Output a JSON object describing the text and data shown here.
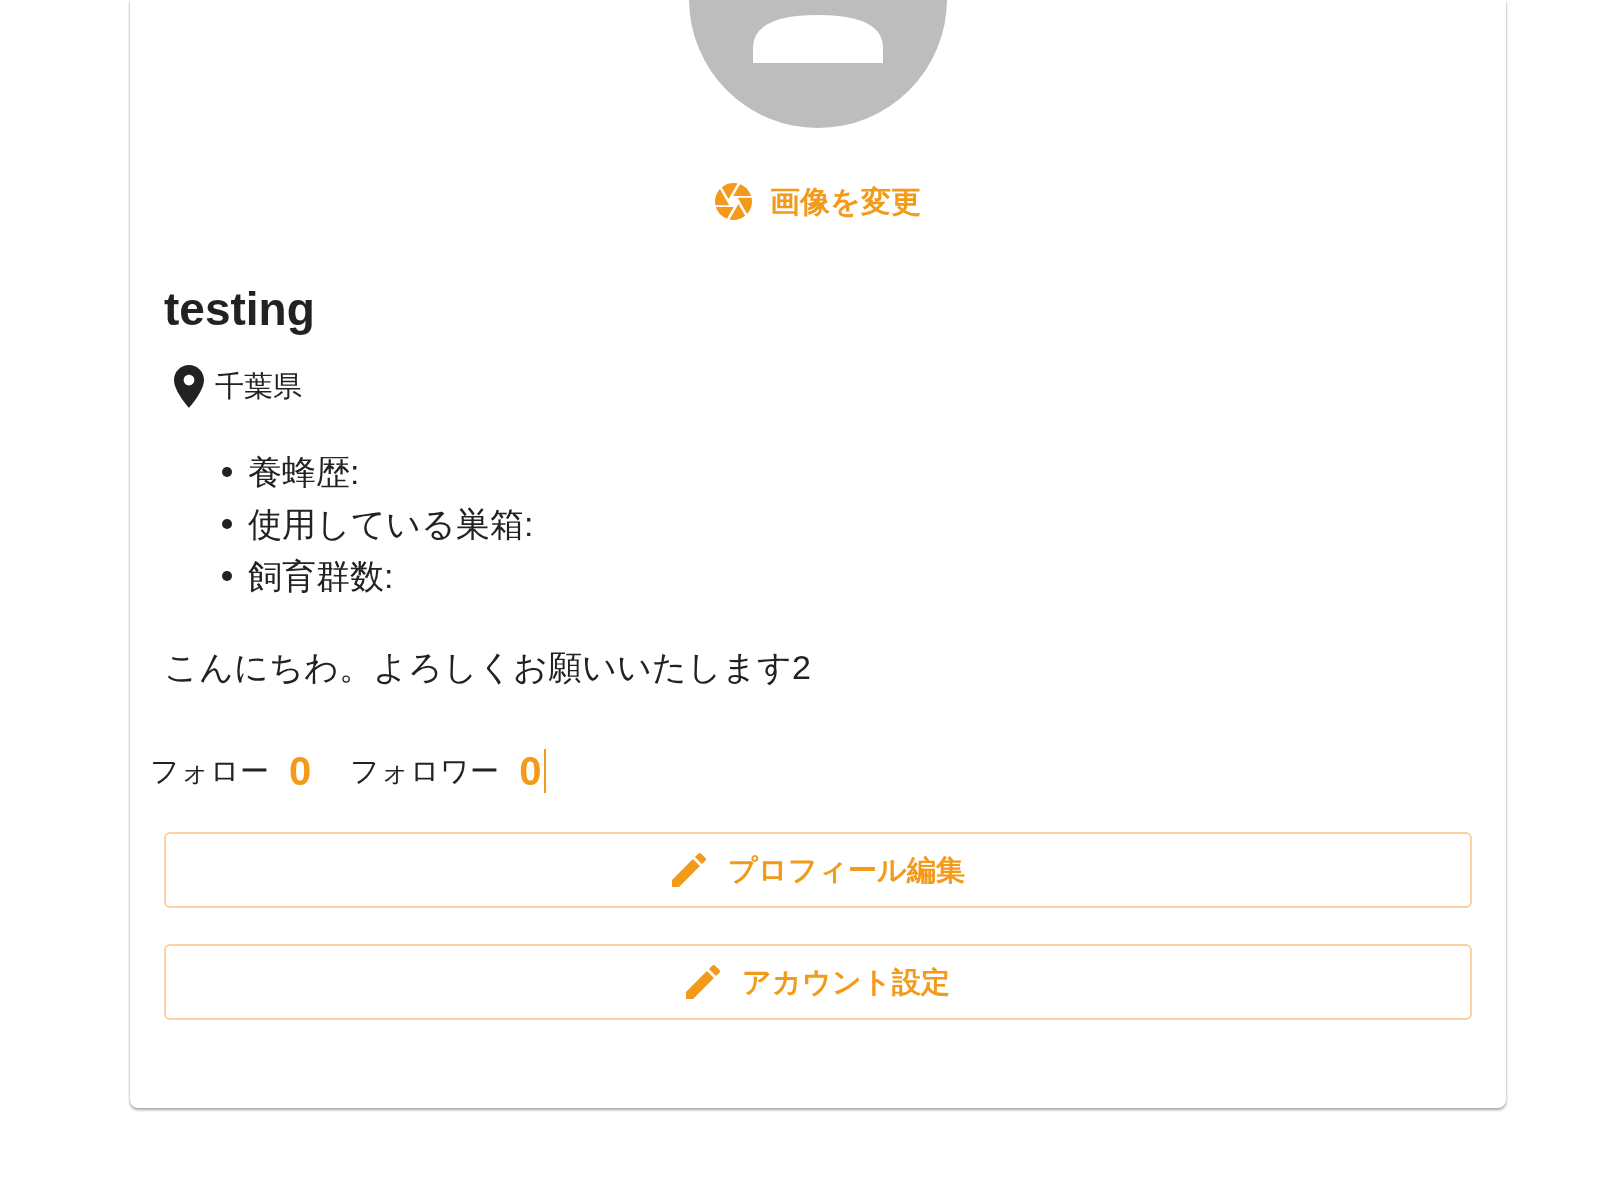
{
  "profile": {
    "change_image": {
      "label": "画像を変更"
    },
    "name": "testing",
    "location": "千葉県",
    "details": [
      "養蜂歴:",
      "使用している巣箱:",
      "飼育群数:"
    ],
    "bio": "こんにちわ。よろしくお願いいたします2",
    "stats": [
      {
        "label": "フォロー",
        "count": "0",
        "caret": false
      },
      {
        "label": "フォロワー",
        "count": "0",
        "caret": true
      }
    ]
  },
  "buttons": [
    {
      "label": "プロフィール編集"
    },
    {
      "label": "アカウント設定"
    }
  ]
}
